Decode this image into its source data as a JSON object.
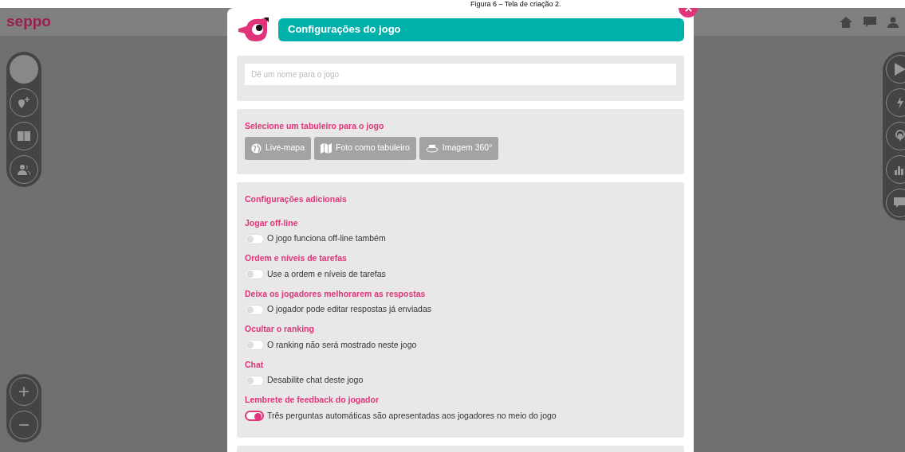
{
  "caption": "Figura 6 – Tela de criação 2.",
  "app": {
    "logo": "seppo"
  },
  "modal": {
    "title": "Configurações do jogo",
    "name_field": {
      "placeholder": "Dê um nome para o jogo"
    },
    "board": {
      "heading": "Selecione um tabuleiro para o jogo",
      "options": [
        {
          "label": "Live-mapa",
          "kind": "globe"
        },
        {
          "label": "Foto como tabuleiro",
          "kind": "map"
        },
        {
          "label": "Imagem 360°",
          "kind": "pano"
        }
      ]
    },
    "additional": {
      "heading": "Configurações adicionais",
      "settings": [
        {
          "heading": "Jogar off-line",
          "label": "O jogo funciona off-line também",
          "on": false
        },
        {
          "heading": "Ordem e níveis de tarefas",
          "label": "Use a ordem e níveis de tarefas",
          "on": false
        },
        {
          "heading": "Deixa os jogadores melhorarem as respostas",
          "label": "O jogador pode editar respostas já enviadas",
          "on": false
        },
        {
          "heading": "Ocultar o ranking",
          "label": "O ranking não será mostrado neste jogo",
          "on": false
        },
        {
          "heading": "Chat",
          "label": "Desabilite chat deste jogo",
          "on": false
        },
        {
          "heading": "Lembrete de feedback do jogador",
          "label": "Três perguntas automáticas são apresentadas aos jogadores no meio do jogo",
          "on": true
        }
      ]
    }
  },
  "zoom": [
    "+",
    "−"
  ]
}
